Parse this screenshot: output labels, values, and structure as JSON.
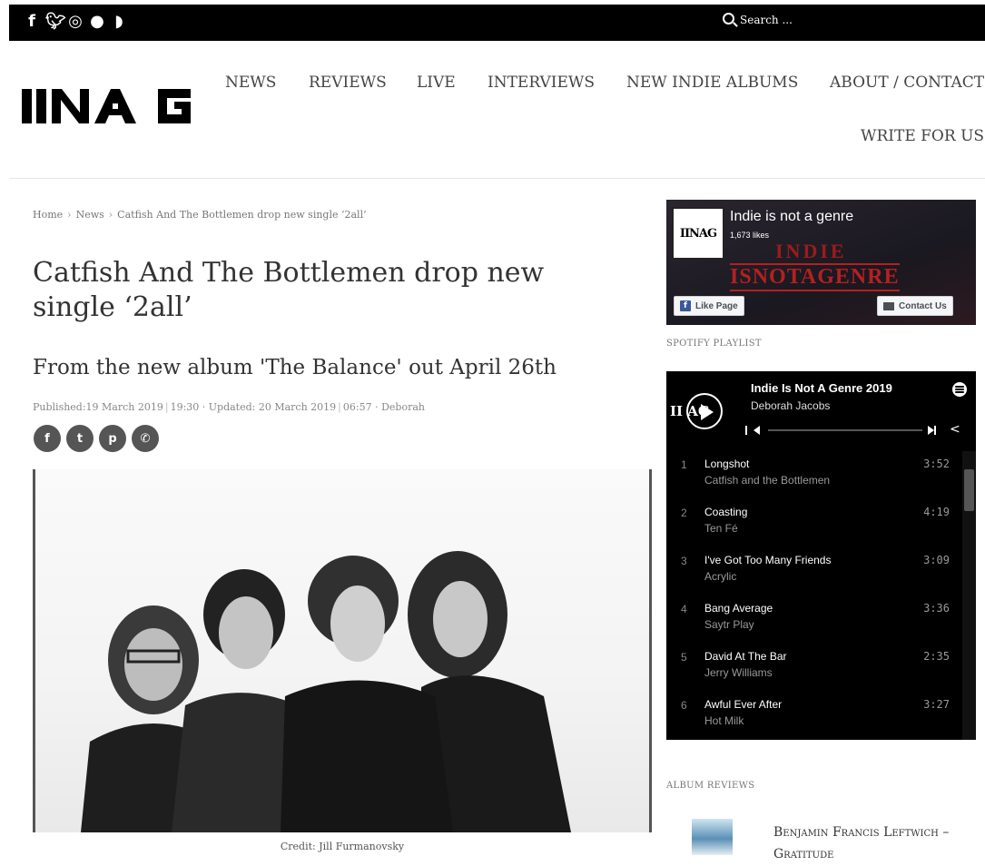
{
  "topbar": {
    "social_icons": [
      "facebook-icon",
      "twitter-icon",
      "instagram-icon",
      "spotify-icon",
      "rss-icon"
    ],
    "search_placeholder": "Search ..."
  },
  "header": {
    "logo_text": "IINAG",
    "nav": [
      "NEWS",
      "REVIEWS",
      "LIVE",
      "INTERVIEWS",
      "NEW INDIE ALBUMS",
      "ABOUT / CONTACT",
      "WRITE FOR US"
    ]
  },
  "article": {
    "breadcrumbs": [
      "Home",
      "News",
      "Catfish And The Bottlemen drop new single ‘2all’"
    ],
    "title": "Catfish And The Bottlemen drop new single ‘2all’",
    "subtitle": "From the new album 'The Balance' out April 26th",
    "published": "Published:19 March 2019",
    "published_time": "19:30",
    "updated": "· Updated: 20 March 2019",
    "updated_time": "06:57",
    "author": "· Deborah",
    "share_icons": [
      "facebook-icon",
      "twitter-icon",
      "pinterest-icon",
      "whatsapp-icon"
    ],
    "image_credit": "Credit: Jill Furmanovsky"
  },
  "sidebar": {
    "facebook": {
      "page_name": "Indie is not a genre",
      "likes": "1,673 likes",
      "logo_text": "IINAG",
      "art_line1": "INDIE",
      "art_line2": "ISNOTAGENRE",
      "like_button": "Like Page",
      "contact_button": "Contact Us"
    },
    "spotify_heading": "Spotify Playlist",
    "spotify": {
      "logo_text": "II AG",
      "playlist_title": "Indie Is Not A Genre 2019",
      "owner": "Deborah Jacobs",
      "tracks": [
        {
          "num": "1",
          "title": "Longshot",
          "artist": "Catfish and the Bottlemen",
          "duration": "3:52"
        },
        {
          "num": "2",
          "title": "Coasting",
          "artist": "Ten Fé",
          "duration": "4:19"
        },
        {
          "num": "3",
          "title": "I've Got Too Many Friends",
          "artist": "Acrylic",
          "duration": "3:09"
        },
        {
          "num": "4",
          "title": "Bang Average",
          "artist": "Saytr Play",
          "duration": "3:36"
        },
        {
          "num": "5",
          "title": "David At The Bar",
          "artist": "Jerry Williams",
          "duration": "2:35"
        },
        {
          "num": "6",
          "title": "Awful Ever After",
          "artist": "Hot Milk",
          "duration": "3:27"
        }
      ]
    },
    "album_reviews_heading": "Album Reviews",
    "album_review": {
      "title": "Benjamin Francis Leftwich – Gratitude"
    }
  }
}
